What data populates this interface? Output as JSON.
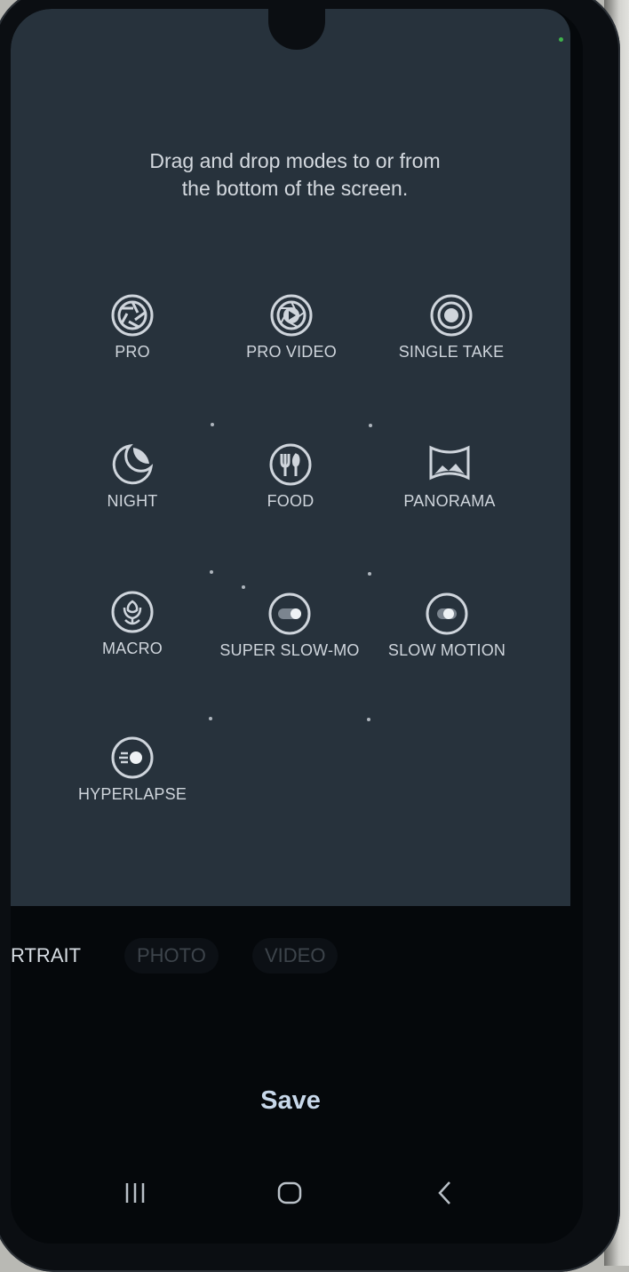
{
  "instruction": {
    "line1": "Drag and drop modes to or from",
    "line2": "the bottom of the screen."
  },
  "modes": [
    {
      "label": "PRO",
      "icon": "aperture-icon"
    },
    {
      "label": "PRO VIDEO",
      "icon": "pro-video-icon"
    },
    {
      "label": "SINGLE TAKE",
      "icon": "single-take-icon"
    },
    {
      "label": "NIGHT",
      "icon": "moon-icon"
    },
    {
      "label": "FOOD",
      "icon": "food-icon"
    },
    {
      "label": "PANORAMA",
      "icon": "panorama-icon"
    },
    {
      "label": "MACRO",
      "icon": "flower-icon"
    },
    {
      "label": "SUPER SLOW-MO",
      "icon": "super-slow-mo-icon"
    },
    {
      "label": "SLOW MOTION",
      "icon": "slow-motion-icon"
    },
    {
      "label": "HYPERLAPSE",
      "icon": "hyperlapse-icon"
    }
  ],
  "bottom_bar": {
    "portrait": "RTRAIT",
    "photo": "PHOTO",
    "video": "VIDEO"
  },
  "save_label": "Save",
  "nav": {
    "recents": "recents-icon",
    "home": "home-icon",
    "back": "back-icon"
  },
  "colors": {
    "edit_area": "#27323c",
    "label_text": "#cfd5dc",
    "save_text": "#c8d8ea",
    "screen_background": "#05080b"
  }
}
